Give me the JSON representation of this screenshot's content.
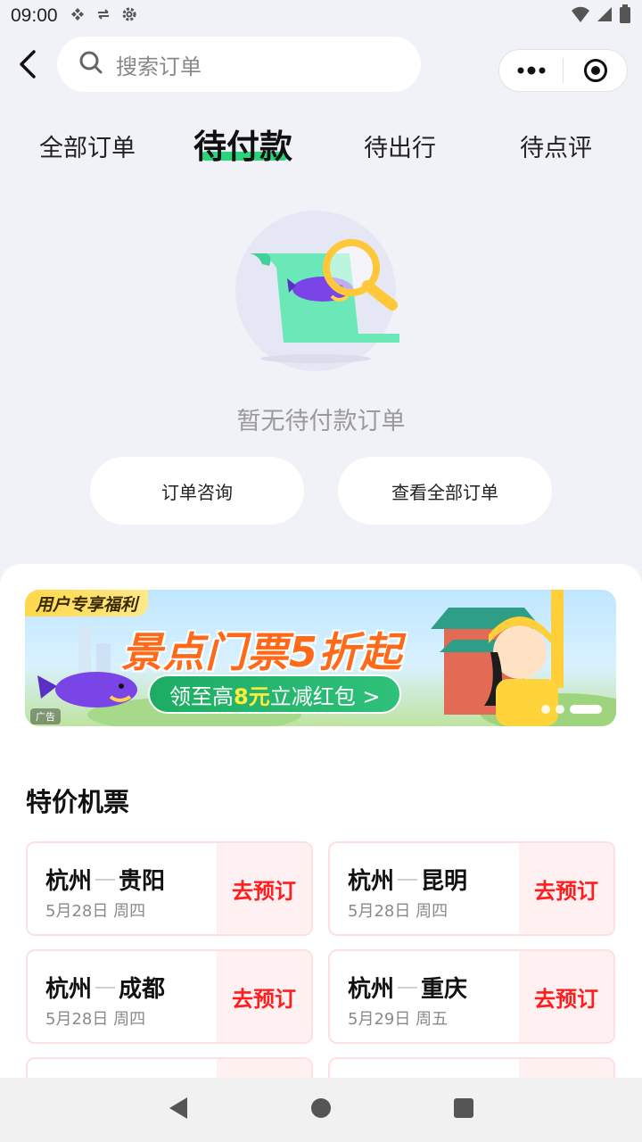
{
  "status_bar": {
    "time": "09:00"
  },
  "search": {
    "placeholder": "搜索订单"
  },
  "tabs": [
    {
      "label": "全部订单"
    },
    {
      "label": "待付款"
    },
    {
      "label": "待出行"
    },
    {
      "label": "待点评"
    }
  ],
  "empty_state": {
    "message": "暂无待付款订单",
    "buttons": [
      "订单咨询",
      "查看全部订单"
    ]
  },
  "banner": {
    "tag": "用户专享福利",
    "headline": "景点门票5折起",
    "sub_prefix": "领至高",
    "sub_highlight": "8元",
    "sub_suffix": "立减红包 >",
    "ad_label": "广告"
  },
  "section": {
    "title": "特价机票"
  },
  "flights": [
    {
      "from": "杭州",
      "to": "贵阳",
      "date": "5月28日 周四",
      "action": "去预订"
    },
    {
      "from": "杭州",
      "to": "昆明",
      "date": "5月28日 周四",
      "action": "去预订"
    },
    {
      "from": "杭州",
      "to": "成都",
      "date": "5月28日 周四",
      "action": "去预订"
    },
    {
      "from": "杭州",
      "to": "重庆",
      "date": "5月29日 周五",
      "action": "去预订"
    }
  ],
  "colors": {
    "accent_green": "#2bd47a",
    "price_red": "#ff1d1d",
    "banner_orange": "#ff6a1a"
  }
}
